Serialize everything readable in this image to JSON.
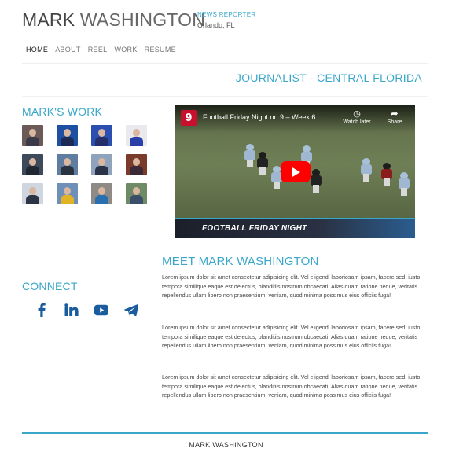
{
  "header": {
    "name_first": "MARK",
    "name_last": "WASHINGTON",
    "role": "NEWS REPORTER",
    "location": "Orlando, FL"
  },
  "nav": {
    "items": [
      {
        "label": "HOME",
        "active": true
      },
      {
        "label": "ABOUT",
        "active": false
      },
      {
        "label": "REEL",
        "active": false
      },
      {
        "label": "WORK",
        "active": false
      },
      {
        "label": "RESUME",
        "active": false
      }
    ]
  },
  "tagline": "JOURNALIST - CENTRAL FLORIDA",
  "work": {
    "title": "MARK'S WORK",
    "thumbnails": [
      {
        "bg": "#6b5a55",
        "suit": "#3a3a4a"
      },
      {
        "bg": "#1f4fa3",
        "suit": "#1d2a55"
      },
      {
        "bg": "#2b4fb0",
        "suit": "#25306b"
      },
      {
        "bg": "#e9e9ee",
        "suit": "#2b3fa8"
      },
      {
        "bg": "#3d4a5c",
        "suit": "#222831"
      },
      {
        "bg": "#5e7da0",
        "suit": "#2b3340"
      },
      {
        "bg": "#8fa3bc",
        "suit": "#2a3347"
      },
      {
        "bg": "#7a3b2a",
        "suit": "#3a2a35"
      },
      {
        "bg": "#cfd6df",
        "suit": "#2d3444"
      },
      {
        "bg": "#6d8fb8",
        "suit": "#e2b325"
      },
      {
        "bg": "#8e8a85",
        "suit": "#2a6fb0"
      },
      {
        "bg": "#6f8a66",
        "suit": "#3b4f6a"
      }
    ]
  },
  "video": {
    "channel_logo": "9",
    "title": "Football Friday Night on 9 – Week 6",
    "watch_later": "Watch later",
    "share": "Share",
    "banner": "FOOTBALL FRIDAY NIGHT"
  },
  "connect": {
    "title": "CONNECT",
    "icons": [
      "facebook-icon",
      "linkedin-icon",
      "youtube-icon",
      "telegram-icon"
    ],
    "color": "#1a5c9e"
  },
  "about": {
    "title": "MEET MARK WASHINGTON",
    "paragraphs": [
      "Lorem ipsum dolor sit amet consectetur adipisicing elit. Vel eligendi laboriosam ipsam, facere sed, iusto tempora similique eaque est delectus, blanditiis nostrum obcaecati. Alias quam ratione neque, veritatis repellendus ullam libero non praesentium, veniam, quod minima possimus eius officiis fuga!",
      "Lorem ipsum dolor sit amet consectetur adipisicing elit. Vel eligendi laboriosam ipsam, facere sed, iusto tempora similique eaque est delectus, blanditiis nostrum obcaecati. Alias quam ratione neque, veritatis repellendus ullam libero non praesentium, veniam, quod minima possimus eius officiis fuga!",
      "Lorem ipsum dolor sit amet consectetur adipisicing elit. Vel eligendi laboriosam ipsam, facere sed, iusto tempora similique eaque est delectus, blanditiis nostrum obcaecati. Alias quam ratione neque, veritatis repellendus ullam libero non praesentium, veniam, quod minima possimus eius officiis fuga!"
    ]
  },
  "footer": {
    "name_first": "MARK",
    "name_last": "WASHINGTON"
  },
  "colors": {
    "accent": "#3aa7c9",
    "youtube_red": "#ff0000"
  }
}
